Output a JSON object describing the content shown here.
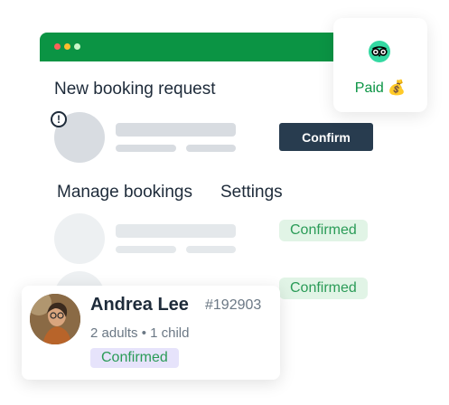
{
  "window": {
    "new_booking_title": "New booking request",
    "confirm_label": "Confirm",
    "nav": {
      "manage_bookings": "Manage bookings",
      "settings": "Settings"
    },
    "rows": [
      {
        "status": "Confirmed"
      },
      {
        "status": "Confirmed"
      }
    ]
  },
  "paid_card": {
    "label": "Paid 💰",
    "icon": "tripadvisor-owl-icon"
  },
  "booking_card": {
    "name": "Andrea Lee",
    "id": "#192903",
    "guests": "2 adults • 1 child",
    "status": "Confirmed"
  },
  "colors": {
    "titlebar": "#0b9444",
    "confirm_button": "#283c4f",
    "confirmed_badge_bg": "#e1f4e6",
    "confirmed_text": "#2a9b57",
    "status_badge_bg": "#e6e3fb",
    "placeholder": "#d8dce1"
  }
}
